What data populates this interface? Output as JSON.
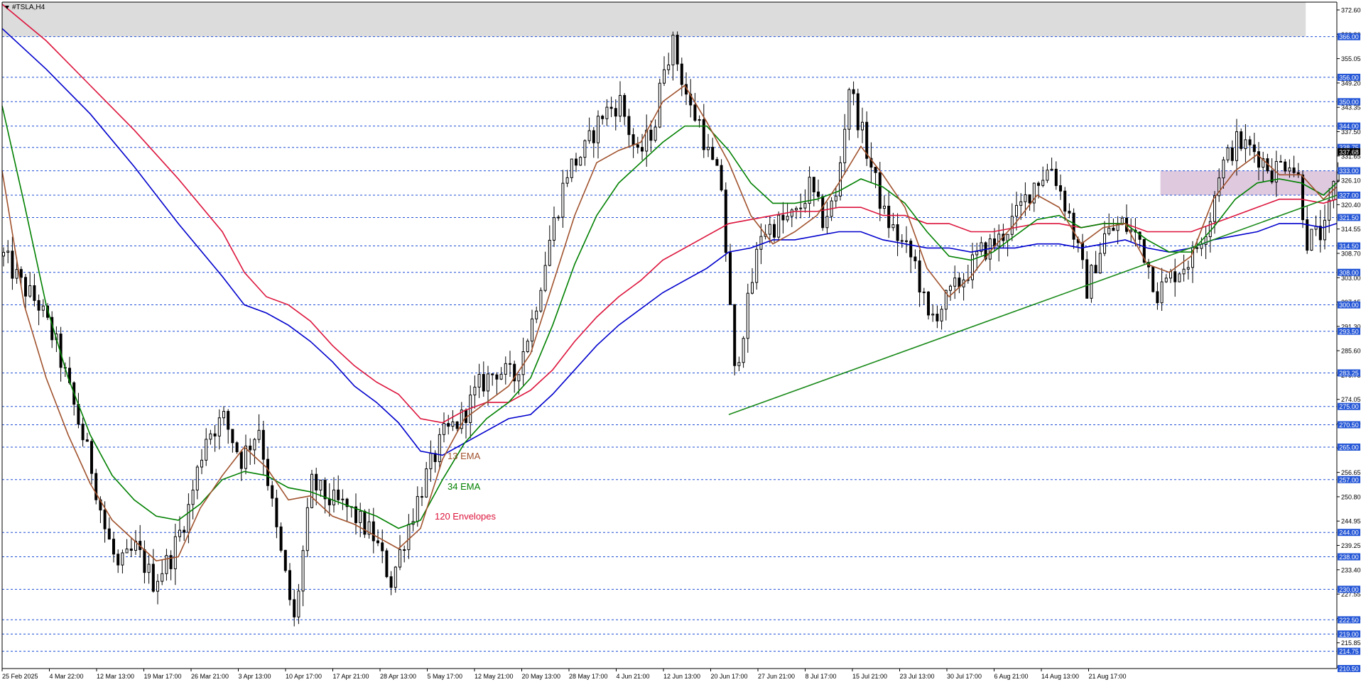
{
  "symbol": "#TSLA,H4",
  "colors": {
    "background": "#ffffff",
    "candle": "#000000",
    "ema13": "#a0522d",
    "ema34": "#008000",
    "envelope120": "#dc143c",
    "sma120": "#0000cd",
    "hline": "#1f4fd6",
    "tag_bg": "#2456d6",
    "trendline": "#1a8a1a",
    "zone_top": "#dcdcdc",
    "zone_box": "#d8bfd8"
  },
  "chart_data": {
    "type": "candlestick",
    "title": "#TSLA,H4",
    "ylim": [
      210.5,
      374.5
    ],
    "grid": false,
    "legend": [
      {
        "label": "13 EMA",
        "color": "#a0522d"
      },
      {
        "label": "34 EMA",
        "color": "#008000"
      },
      {
        "label": "120 Envelopes",
        "color": "#dc143c"
      }
    ],
    "x_tick_labels": [
      "25 Feb 2025",
      "4 Mar 22:00",
      "12 Mar 13:00",
      "19 Mar 17:00",
      "26 Mar 21:00",
      "3 Apr 13:00",
      "10 Apr 17:00",
      "17 Apr 21:00",
      "28 Apr 13:00",
      "5 May 17:00",
      "12 May 21:00",
      "20 May 13:00",
      "28 May 17:00",
      "4 Jun 21:00",
      "12 Jun 13:00",
      "20 Jun 17:00",
      "27 Jun 21:00",
      "8 Jul 17:00",
      "15 Jul 21:00",
      "23 Jul 13:00",
      "30 Jul 17:00",
      "6 Aug 21:00",
      "14 Aug 13:00",
      "21 Aug 17:00"
    ],
    "y_tick_labels": [
      "372.60",
      "360.90",
      "355.05",
      "349.20",
      "343.35",
      "337.50",
      "331.65",
      "326.10",
      "320.40",
      "314.55",
      "308.70",
      "303.00",
      "297.15",
      "291.30",
      "285.60",
      "279.75",
      "274.05",
      "268.20",
      "262.35",
      "256.65",
      "250.80",
      "244.95",
      "239.25",
      "233.40",
      "227.55",
      "221.70",
      "215.85",
      "210.15"
    ],
    "levels": [
      "366.00",
      "356.00",
      "350.00",
      "344.00",
      "338.75",
      "333.00",
      "327.00",
      "321.50",
      "314.50",
      "308.00",
      "300.00",
      "293.50",
      "283.25",
      "275.00",
      "270.50",
      "265.00",
      "257.00",
      "244.00",
      "238.00",
      "230.00",
      "222.50",
      "219.00",
      "214.75",
      "210.50"
    ],
    "last_price": "337.68",
    "price_path": [
      [
        0,
        312
      ],
      [
        4,
        305
      ],
      [
        8,
        300
      ],
      [
        12,
        290
      ],
      [
        16,
        275
      ],
      [
        20,
        260
      ],
      [
        23,
        245
      ],
      [
        26,
        235
      ],
      [
        30,
        240
      ],
      [
        34,
        232
      ],
      [
        38,
        238
      ],
      [
        42,
        250
      ],
      [
        46,
        268
      ],
      [
        50,
        272
      ],
      [
        54,
        262
      ],
      [
        58,
        270
      ],
      [
        62,
        244
      ],
      [
        66,
        222
      ],
      [
        70,
        256
      ],
      [
        74,
        252
      ],
      [
        78,
        250
      ],
      [
        84,
        243
      ],
      [
        88,
        232
      ],
      [
        92,
        246
      ],
      [
        96,
        258
      ],
      [
        100,
        268
      ],
      [
        104,
        272
      ],
      [
        108,
        280
      ],
      [
        112,
        284
      ],
      [
        116,
        282
      ],
      [
        120,
        296
      ],
      [
        124,
        316
      ],
      [
        128,
        333
      ],
      [
        132,
        338
      ],
      [
        136,
        347
      ],
      [
        140,
        350
      ],
      [
        144,
        336
      ],
      [
        148,
        345
      ],
      [
        150,
        360
      ],
      [
        152,
        364
      ],
      [
        154,
        356
      ],
      [
        156,
        348
      ],
      [
        158,
        345
      ],
      [
        160,
        337
      ],
      [
        163,
        329
      ],
      [
        166,
        283
      ],
      [
        169,
        300
      ],
      [
        172,
        318
      ],
      [
        176,
        320
      ],
      [
        180,
        322
      ],
      [
        183,
        329
      ],
      [
        186,
        321
      ],
      [
        189,
        326
      ],
      [
        192,
        354
      ],
      [
        196,
        338
      ],
      [
        200,
        322
      ],
      [
        204,
        315
      ],
      [
        207,
        310
      ],
      [
        210,
        296
      ],
      [
        214,
        301
      ],
      [
        218,
        307
      ],
      [
        222,
        313
      ],
      [
        226,
        316
      ],
      [
        230,
        322
      ],
      [
        234,
        330
      ],
      [
        238,
        334
      ],
      [
        242,
        322
      ],
      [
        246,
        304
      ],
      [
        250,
        317
      ],
      [
        254,
        320
      ],
      [
        258,
        316
      ],
      [
        262,
        303
      ],
      [
        266,
        308
      ],
      [
        270,
        312
      ],
      [
        274,
        322
      ],
      [
        276,
        333
      ],
      [
        280,
        340
      ],
      [
        284,
        338
      ],
      [
        288,
        333
      ],
      [
        292,
        336
      ],
      [
        294,
        331
      ],
      [
        296,
        316
      ],
      [
        300,
        318
      ],
      [
        303,
        334
      ]
    ],
    "ema13": [
      [
        0,
        333
      ],
      [
        5,
        300
      ],
      [
        10,
        282
      ],
      [
        15,
        268
      ],
      [
        20,
        256
      ],
      [
        25,
        247
      ],
      [
        30,
        242
      ],
      [
        35,
        237
      ],
      [
        40,
        238
      ],
      [
        45,
        250
      ],
      [
        50,
        258
      ],
      [
        55,
        265
      ],
      [
        60,
        260
      ],
      [
        65,
        252
      ],
      [
        70,
        253
      ],
      [
        75,
        248
      ],
      [
        80,
        246
      ],
      [
        85,
        243
      ],
      [
        90,
        240
      ],
      [
        95,
        245
      ],
      [
        100,
        262
      ],
      [
        105,
        272
      ],
      [
        110,
        276
      ],
      [
        115,
        280
      ],
      [
        120,
        288
      ],
      [
        125,
        305
      ],
      [
        130,
        322
      ],
      [
        135,
        335
      ],
      [
        140,
        338
      ],
      [
        145,
        340
      ],
      [
        150,
        350
      ],
      [
        155,
        354
      ],
      [
        160,
        345
      ],
      [
        165,
        335
      ],
      [
        170,
        322
      ],
      [
        175,
        315
      ],
      [
        180,
        318
      ],
      [
        185,
        322
      ],
      [
        190,
        330
      ],
      [
        195,
        339
      ],
      [
        200,
        332
      ],
      [
        205,
        324
      ],
      [
        210,
        309
      ],
      [
        215,
        302
      ],
      [
        220,
        307
      ],
      [
        225,
        314
      ],
      [
        230,
        320
      ],
      [
        235,
        327
      ],
      [
        240,
        324
      ],
      [
        245,
        315
      ],
      [
        250,
        319
      ],
      [
        255,
        320
      ],
      [
        260,
        310
      ],
      [
        265,
        308
      ],
      [
        270,
        312
      ],
      [
        275,
        326
      ],
      [
        280,
        333
      ],
      [
        285,
        337
      ],
      [
        290,
        332
      ],
      [
        295,
        332
      ],
      [
        300,
        326
      ],
      [
        303,
        329
      ]
    ],
    "ema34": [
      [
        0,
        349
      ],
      [
        5,
        325
      ],
      [
        10,
        300
      ],
      [
        15,
        282
      ],
      [
        20,
        268
      ],
      [
        25,
        258
      ],
      [
        30,
        252
      ],
      [
        35,
        248
      ],
      [
        40,
        247
      ],
      [
        45,
        251
      ],
      [
        50,
        257
      ],
      [
        55,
        259
      ],
      [
        60,
        258
      ],
      [
        65,
        255
      ],
      [
        70,
        254
      ],
      [
        75,
        252
      ],
      [
        80,
        250
      ],
      [
        85,
        248
      ],
      [
        90,
        245
      ],
      [
        95,
        247
      ],
      [
        100,
        257
      ],
      [
        105,
        266
      ],
      [
        110,
        272
      ],
      [
        115,
        276
      ],
      [
        120,
        282
      ],
      [
        125,
        295
      ],
      [
        130,
        310
      ],
      [
        135,
        322
      ],
      [
        140,
        330
      ],
      [
        145,
        335
      ],
      [
        150,
        340
      ],
      [
        155,
        344
      ],
      [
        160,
        344
      ],
      [
        165,
        338
      ],
      [
        170,
        330
      ],
      [
        175,
        325
      ],
      [
        180,
        325
      ],
      [
        185,
        326
      ],
      [
        190,
        328
      ],
      [
        195,
        331
      ],
      [
        200,
        329
      ],
      [
        205,
        325
      ],
      [
        210,
        318
      ],
      [
        215,
        312
      ],
      [
        220,
        311
      ],
      [
        225,
        313
      ],
      [
        230,
        317
      ],
      [
        235,
        321
      ],
      [
        240,
        322
      ],
      [
        245,
        319
      ],
      [
        250,
        320
      ],
      [
        255,
        320
      ],
      [
        260,
        316
      ],
      [
        265,
        313
      ],
      [
        270,
        313
      ],
      [
        275,
        319
      ],
      [
        280,
        326
      ],
      [
        285,
        330
      ],
      [
        290,
        331
      ],
      [
        295,
        330
      ],
      [
        300,
        327
      ],
      [
        303,
        330
      ]
    ],
    "envelope120": [
      [
        0,
        374
      ],
      [
        10,
        365
      ],
      [
        20,
        354
      ],
      [
        30,
        343
      ],
      [
        40,
        331
      ],
      [
        50,
        318
      ],
      [
        55,
        308
      ],
      [
        60,
        302
      ],
      [
        65,
        300
      ],
      [
        70,
        296
      ],
      [
        75,
        290
      ],
      [
        80,
        285
      ],
      [
        85,
        281
      ],
      [
        90,
        278
      ],
      [
        95,
        272
      ],
      [
        100,
        271
      ],
      [
        105,
        274
      ],
      [
        110,
        276
      ],
      [
        115,
        276
      ],
      [
        120,
        279
      ],
      [
        125,
        284
      ],
      [
        130,
        291
      ],
      [
        135,
        297
      ],
      [
        140,
        302
      ],
      [
        145,
        306
      ],
      [
        150,
        311
      ],
      [
        155,
        314
      ],
      [
        160,
        317
      ],
      [
        165,
        320
      ],
      [
        170,
        321
      ],
      [
        175,
        322
      ],
      [
        180,
        323
      ],
      [
        185,
        323
      ],
      [
        190,
        324
      ],
      [
        195,
        324
      ],
      [
        200,
        322
      ],
      [
        205,
        322
      ],
      [
        210,
        320
      ],
      [
        215,
        320
      ],
      [
        220,
        318
      ],
      [
        225,
        318
      ],
      [
        230,
        319
      ],
      [
        235,
        320
      ],
      [
        240,
        320
      ],
      [
        245,
        319
      ],
      [
        250,
        320
      ],
      [
        255,
        320
      ],
      [
        260,
        318
      ],
      [
        265,
        318
      ],
      [
        270,
        318
      ],
      [
        275,
        320
      ],
      [
        280,
        322
      ],
      [
        285,
        324
      ],
      [
        290,
        326
      ],
      [
        295,
        326
      ],
      [
        300,
        325
      ],
      [
        303,
        326
      ]
    ],
    "sma120": [
      [
        0,
        368
      ],
      [
        10,
        358
      ],
      [
        20,
        347
      ],
      [
        30,
        334
      ],
      [
        40,
        320
      ],
      [
        50,
        307
      ],
      [
        55,
        300
      ],
      [
        60,
        298
      ],
      [
        65,
        295
      ],
      [
        70,
        291
      ],
      [
        75,
        286
      ],
      [
        80,
        280
      ],
      [
        85,
        276
      ],
      [
        90,
        271
      ],
      [
        95,
        264
      ],
      [
        100,
        263
      ],
      [
        105,
        266
      ],
      [
        110,
        269
      ],
      [
        115,
        272
      ],
      [
        120,
        273
      ],
      [
        125,
        278
      ],
      [
        130,
        284
      ],
      [
        135,
        290
      ],
      [
        140,
        295
      ],
      [
        145,
        299
      ],
      [
        150,
        303
      ],
      [
        155,
        306
      ],
      [
        160,
        309
      ],
      [
        165,
        313
      ],
      [
        170,
        314
      ],
      [
        175,
        316
      ],
      [
        180,
        316
      ],
      [
        185,
        317
      ],
      [
        190,
        318
      ],
      [
        195,
        318
      ],
      [
        200,
        316
      ],
      [
        205,
        315
      ],
      [
        210,
        314
      ],
      [
        215,
        314
      ],
      [
        220,
        313
      ],
      [
        225,
        314
      ],
      [
        230,
        314
      ],
      [
        235,
        315
      ],
      [
        240,
        315
      ],
      [
        245,
        314
      ],
      [
        250,
        315
      ],
      [
        255,
        316
      ],
      [
        260,
        314
      ],
      [
        265,
        313
      ],
      [
        270,
        314
      ],
      [
        275,
        316
      ],
      [
        280,
        317
      ],
      [
        285,
        318
      ],
      [
        290,
        320
      ],
      [
        295,
        320
      ],
      [
        300,
        319
      ],
      [
        303,
        320
      ]
    ],
    "trendline": [
      [
        165,
        273
      ],
      [
        365,
        327
      ]
    ],
    "zones": [
      {
        "name": "top-resistance-zone",
        "x0": 0,
        "x1": 296,
        "y0": 366,
        "y1": 374.5
      },
      {
        "name": "purple-zone",
        "x0": 263,
        "x1": 306,
        "y0": 327,
        "y1": 333
      }
    ]
  }
}
